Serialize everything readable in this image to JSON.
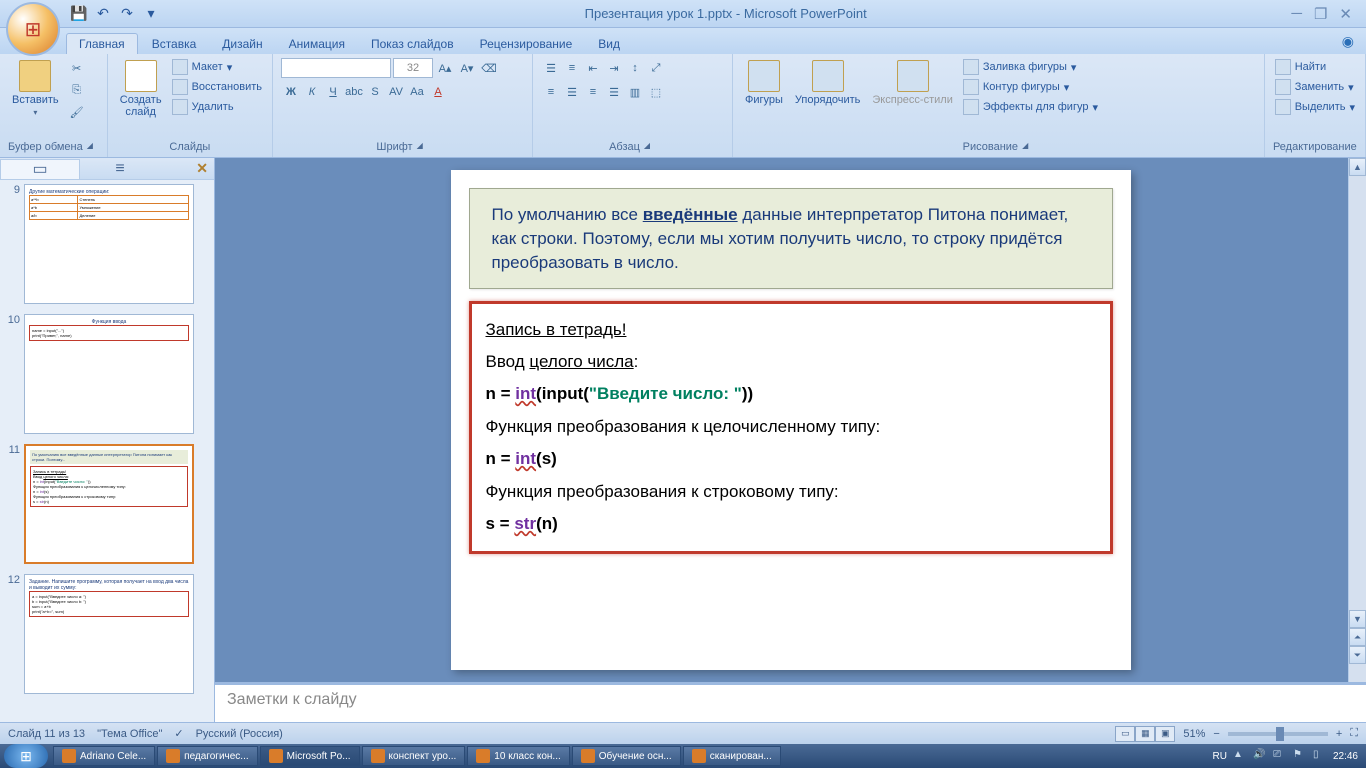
{
  "title": "Презентация урок 1.pptx - Microsoft PowerPoint",
  "tabs": [
    "Главная",
    "Вставка",
    "Дизайн",
    "Анимация",
    "Показ слайдов",
    "Рецензирование",
    "Вид"
  ],
  "active_tab": 0,
  "ribbon_groups": {
    "clipboard": {
      "label": "Буфер обмена",
      "paste": "Вставить"
    },
    "slides": {
      "label": "Слайды",
      "new": "Создать\nслайд",
      "layout": "Макет",
      "reset": "Восстановить",
      "delete": "Удалить"
    },
    "font": {
      "label": "Шрифт",
      "size": "32"
    },
    "paragraph": {
      "label": "Абзац"
    },
    "drawing": {
      "label": "Рисование",
      "shapes": "Фигуры",
      "arrange": "Упорядочить",
      "styles": "Экспресс-стили",
      "fill": "Заливка фигуры",
      "outline": "Контур фигуры",
      "effects": "Эффекты для фигур"
    },
    "editing": {
      "label": "Редактирование",
      "find": "Найти",
      "replace": "Заменить",
      "select": "Выделить"
    }
  },
  "slide_content": {
    "info_text_pre": "По умолчанию все ",
    "info_text_underline": "введённые",
    "info_text_post": " данные интерпретатор Питона понимает, как строки. Поэтому, если мы хотим получить число, то строку придётся преобразовать в число.",
    "notebook_title": "Запись в тетрадь!",
    "line1_pre": "Ввод ",
    "line1_u": "целого числа",
    "line1_post": ":",
    "code1_pre": "n = ",
    "code1_kw": "int",
    "code1_mid": "(input(",
    "code1_str": "\"Введите число: \"",
    "code1_end": "))",
    "line2": "Функция преобразования к целочисленному типу:",
    "code2_pre": "n = ",
    "code2_kw": "int",
    "code2_end": "(s)",
    "line3": "Функция преобразования к строковому типу:",
    "code3_pre": "s = ",
    "code3_kw": "str",
    "code3_end": "(n)"
  },
  "notes_placeholder": "Заметки к слайду",
  "thumbs": [
    {
      "n": "9"
    },
    {
      "n": "10"
    },
    {
      "n": "11"
    },
    {
      "n": "12"
    }
  ],
  "selected_thumb": 2,
  "status": {
    "slide": "Слайд 11 из 13",
    "theme": "\"Тема Office\"",
    "lang": "Русский (Россия)",
    "zoom": "51%"
  },
  "taskbar": [
    {
      "label": "Adriano Cele..."
    },
    {
      "label": "педагогичес..."
    },
    {
      "label": "Microsoft Po...",
      "active": true
    },
    {
      "label": "конспект уро..."
    },
    {
      "label": "10 класс кон..."
    },
    {
      "label": "Обучение осн..."
    },
    {
      "label": "сканирован..."
    }
  ],
  "tray": {
    "lang": "RU",
    "time": "22:46"
  }
}
